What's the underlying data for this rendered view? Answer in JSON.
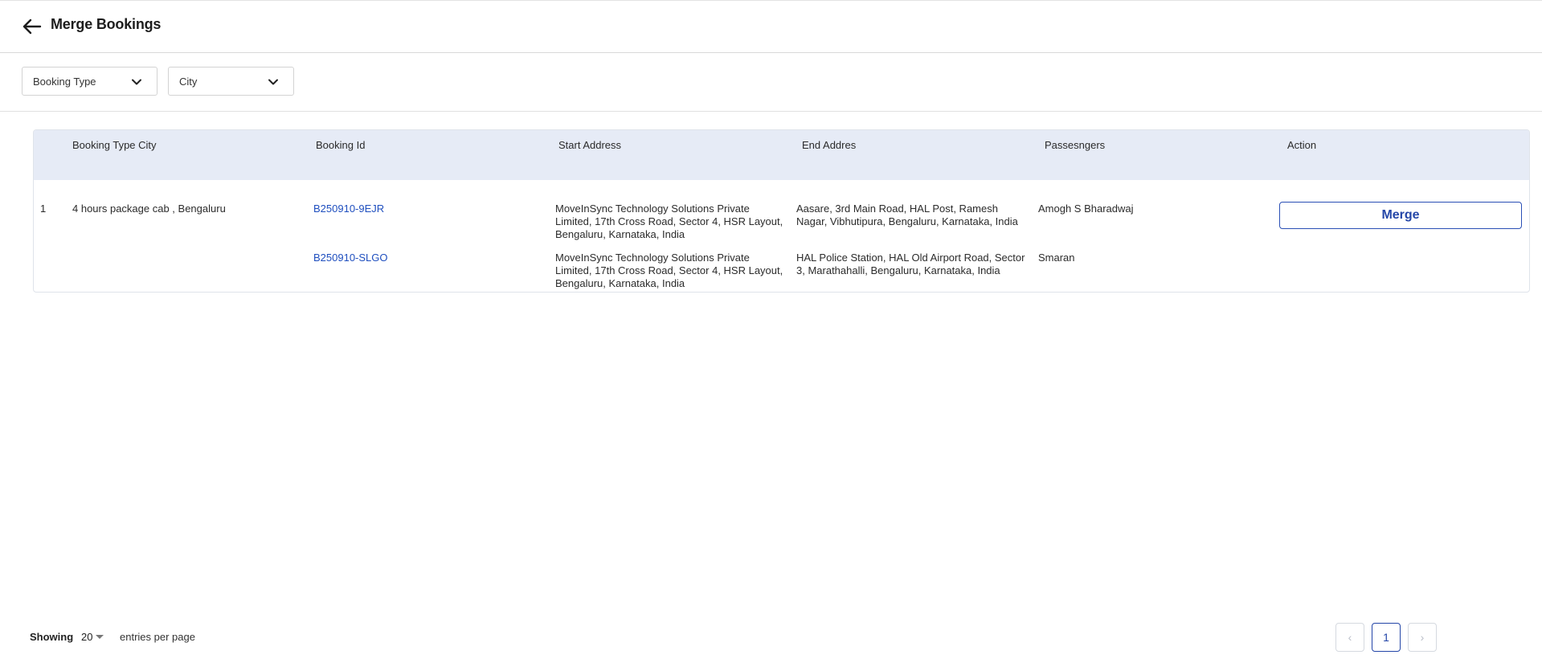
{
  "header": {
    "title": "Merge Bookings",
    "back_icon": "arrow-left-icon"
  },
  "filters": [
    {
      "label": "Booking Type",
      "icon": "chevron-down-icon"
    },
    {
      "label": "City",
      "icon": "chevron-down-icon"
    }
  ],
  "table": {
    "columns": [
      "Booking Type City",
      "Booking Id",
      "Start Address",
      "End Addres",
      "Passesngers",
      "Action"
    ],
    "group": {
      "index": "1",
      "type_city": "4 hours package cab , Bengaluru",
      "action_label": "Merge",
      "rows": [
        {
          "booking_id": "B250910-9EJR",
          "start_address": "MoveInSync Technology Solutions Private Limited, 17th Cross Road, Sector 4, HSR Layout, Bengaluru, Karnataka, India",
          "end_address": "Aasare, 3rd Main Road, HAL Post, Ramesh Nagar, Vibhutipura, Bengaluru, Karnataka, India",
          "passenger": "Amogh S Bharadwaj"
        },
        {
          "booking_id": "B250910-SLGO",
          "start_address": "MoveInSync Technology Solutions Private Limited, 17th Cross Road, Sector 4, HSR Layout, Bengaluru, Karnataka, India",
          "end_address": "HAL Police Station, HAL Old Airport Road, Sector 3, Marathahalli, Bengaluru, Karnataka, India",
          "passenger": "Smaran"
        }
      ]
    }
  },
  "footer": {
    "showing_label": "Showing",
    "per_page": "20",
    "entries_label": "entries per page",
    "prev_symbol": "‹",
    "current_page": "1",
    "next_symbol": "›"
  },
  "colors": {
    "accent": "#2446a8",
    "header_bg": "#e6ebf6",
    "link": "#1f4fbf"
  }
}
